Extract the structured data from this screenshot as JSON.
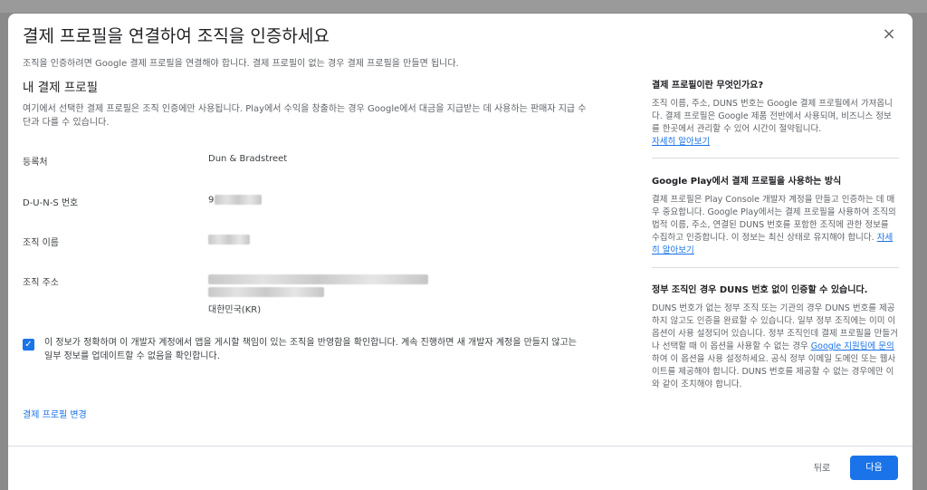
{
  "dialog": {
    "title": "결제 프로필을 연결하여 조직을 인증하세요",
    "subtitle": "조직을 인증하려면 Google 결제 프로필을 연결해야 합니다. 결제 프로필이 없는 경우 결제 프로필을 만들면 됩니다.",
    "close_icon": "×"
  },
  "profile": {
    "title": "내 결제 프로필",
    "description": "여기에서 선택한 결제 프로필은 조직 인증에만 사용됩니다. Play에서 수익을 창출하는 경우 Google에서 대금을 지급받는 데 사용하는 판매자 지급 수단과 다를 수 있습니다.",
    "fields": [
      {
        "label": "등록처",
        "value": "Dun & Bradstreet"
      },
      {
        "label": "D-U-N-S 번호",
        "value": "9"
      },
      {
        "label": "조직 이름",
        "value": ""
      },
      {
        "label": "조직 주소",
        "value": "대한민국(KR)"
      }
    ],
    "confirm_text": "이 정보가 정확하며 이 개발자 계정에서 앱을 게시할 책임이 있는 조직을 반영함을 확인합니다. 계속 진행하면 새 개발자 계정을 만들지 않고는 일부 정보를 업데이트할 수 없음을 확인합니다.",
    "change_link": "결제 프로필 변경"
  },
  "help": {
    "block1": {
      "title": "결제 프로필이란 무엇인가요?",
      "text": "조직 이름, 주소, DUNS 번호는 Google 결제 프로필에서 가져옵니다. 결제 프로필은 Google 제품 전반에서 사용되며, 비즈니스 정보를 한곳에서 관리할 수 있어 시간이 절약됩니다.",
      "link": "자세히 알아보기"
    },
    "block2": {
      "title": "Google Play에서 결제 프로필을 사용하는 방식",
      "text": "결제 프로필은 Play Console 개발자 계정을 만들고 인증하는 데 매우 중요합니다. Google Play에서는 결제 프로필을 사용하여 조직의 법적 이름, 주소, 연결된 DUNS 번호를 포함한 조직에 관한 정보를 수집하고 인증합니다. 이 정보는 최신 상태로 유지해야 합니다.",
      "link": "자세히 알아보기"
    },
    "block3": {
      "title": "정부 조직인 경우 DUNS 번호 없이 인증할 수 있습니다.",
      "text_before": "DUNS 번호가 없는 정부 조직 또는 기관의 경우 DUNS 번호를 제공하지 않고도 인증을 완료할 수 있습니다. 일부 정부 조직에는 이미 이 옵션이 사용 설정되어 있습니다. 정부 조직인데 결제 프로필을 만들거나 선택할 때 이 옵션을 사용할 수 없는 경우 ",
      "link": "Google 지원팀에 문의",
      "text_after": "하여 이 옵션을 사용 설정하세요. 공식 정부 이메일 도메인 또는 웹사이트를 제공해야 합니다. DUNS 번호를 제공할 수 없는 경우에만 이와 같이 조치해야 합니다."
    }
  },
  "footer": {
    "back_label": "뒤로",
    "next_label": "다음"
  },
  "colors": {
    "accent": "#1a73e8",
    "backdrop": "#8a8a8a"
  }
}
